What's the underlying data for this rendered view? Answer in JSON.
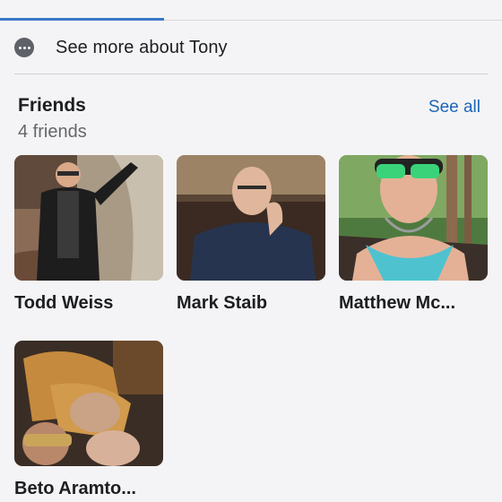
{
  "about": {
    "see_more_label": "See more about Tony"
  },
  "friends": {
    "title": "Friends",
    "count_label": "4 friends",
    "see_all_label": "See all",
    "items": [
      {
        "name": "Todd Weiss",
        "photo": "photo of man in black jacket waving outdoors"
      },
      {
        "name": "Mark Staib",
        "photo": "photo of man in blue sweater resting head on hand"
      },
      {
        "name": "Matthew Mc...",
        "photo": "selfie of man wearing green mirrored sunglasses"
      },
      {
        "name": "Beto Aramto...",
        "photo": "group photo with gold sunglasses at a party"
      }
    ]
  },
  "colors": {
    "accent": "#1c65b5",
    "tab_indicator": "#3b78c9",
    "background": "#f4f4f6",
    "secondary_text": "#65676b"
  }
}
